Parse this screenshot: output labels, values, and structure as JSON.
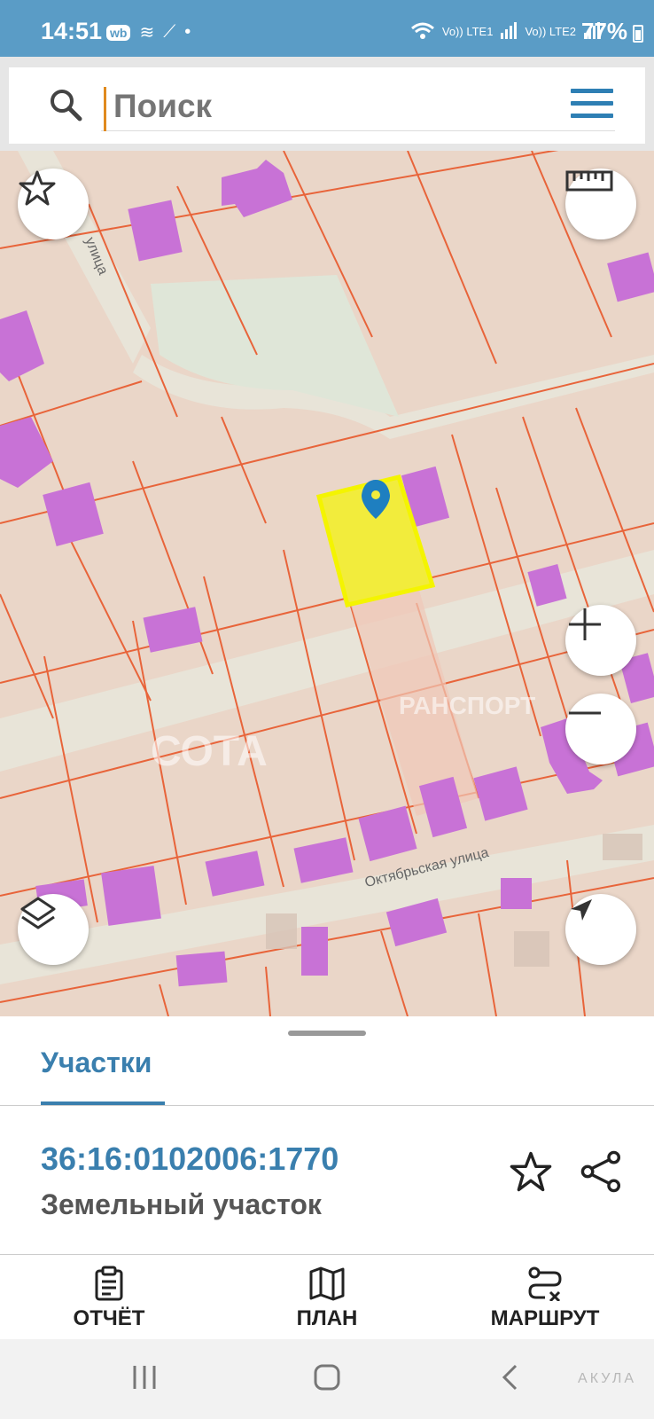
{
  "status_bar": {
    "time": "14:51",
    "wb_badge": "wb",
    "sim1": "Vo)) LTE1",
    "sim2": "Vo)) LTE2",
    "battery": "77%"
  },
  "search": {
    "placeholder": "Поиск",
    "value": ""
  },
  "map": {
    "street_top": "улица",
    "street_bottom": "Октябрьская улица",
    "watermark_left": "СОТА",
    "watermark_right": "РАНСПОРТ",
    "icons": {
      "favorites": "star-icon",
      "ruler": "ruler-icon",
      "layers": "layers-icon",
      "zoom_in": "plus-icon",
      "zoom_out": "minus-icon",
      "locate": "navigation-arrow-icon",
      "pin": "location-pin-icon"
    },
    "colors": {
      "parcel_fill": "#ead6c8",
      "parcel_border": "#e8643a",
      "building": "#c872d6",
      "road": "#e8e4d8",
      "selected_parcel": "#f2ec3c",
      "pin": "#1e7fc0"
    }
  },
  "sheet": {
    "tab_label": "Участки",
    "parcel_id": "36:16:0102006:1770",
    "parcel_type": "Земельный участок"
  },
  "bottom_nav": {
    "report_label": "ОТЧЁТ",
    "plan_label": "ПЛАН",
    "route_label": "МАРШРУТ"
  },
  "system_nav": {
    "watermark": "АКУЛА"
  }
}
